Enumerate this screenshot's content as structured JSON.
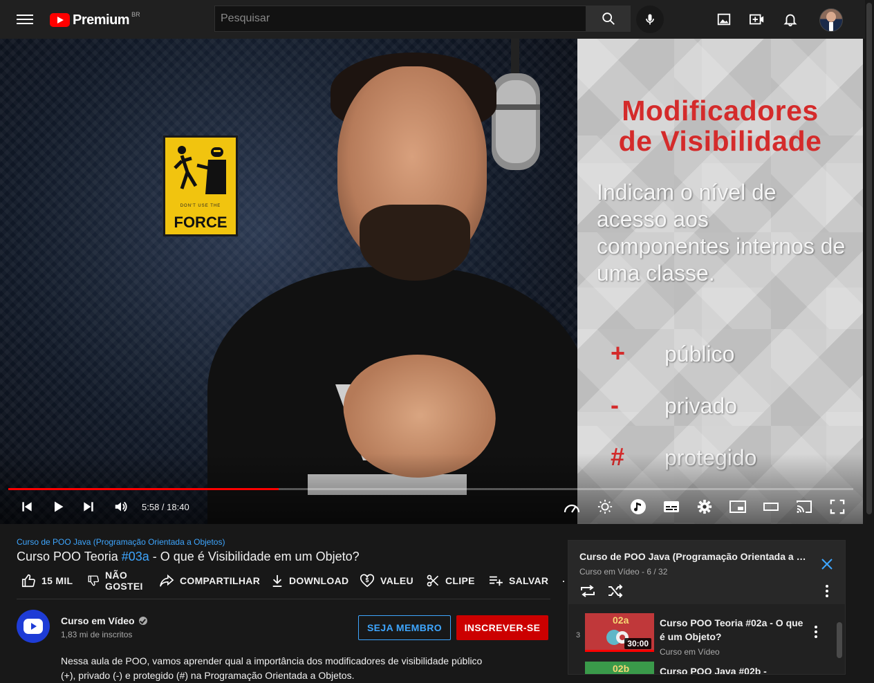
{
  "header": {
    "logo_text": "Premium",
    "country_code": "BR",
    "search_placeholder": "Pesquisar",
    "icons": [
      "menu-icon",
      "search-icon",
      "microphone-icon",
      "image-icon",
      "create-video-icon",
      "bell-icon"
    ]
  },
  "player": {
    "time_display": "5:58 / 18:40",
    "progress_fraction": 0.32,
    "slide": {
      "title_line1": "Modificadores",
      "title_line2": "de Visibilidade",
      "body": "Indicam o nível de acesso aos componentes internos de uma classe.",
      "items": [
        {
          "symbol": "+",
          "label": "público"
        },
        {
          "symbol": "-",
          "label": "privado"
        },
        {
          "symbol": "#",
          "label": "protegido"
        }
      ]
    },
    "sign": {
      "small_text": "DON'T USE THE",
      "big_text": "FORCE"
    }
  },
  "video": {
    "playlist_link": "Curso de POO Java (Programação Orientada a Objetos)",
    "title_prefix": "Curso POO Teoria ",
    "title_tag": "#03a",
    "title_suffix": " - O que é Visibilidade em um Objeto?",
    "actions": {
      "like": "15 MIL",
      "dislike_line1": "NÃO",
      "dislike_line2": "GOSTEI",
      "share": "COMPARTILHAR",
      "download": "DOWNLOAD",
      "thanks": "VALEU",
      "clip": "CLIPE",
      "save": "SALVAR",
      "more": "···"
    }
  },
  "channel": {
    "name": "Curso em Vídeo",
    "subscribers": "1,83 mi de inscritos",
    "member_label": "SEJA MEMBRO",
    "subscribe_label": "INSCREVER-SE",
    "description_line1": "Nessa aula de POO, vamos aprender qual a importância dos modificadores de visibilidade público",
    "description_line2": "(+), privado (-) e protegido (#) na Programação Orientada a Objetos."
  },
  "playlist": {
    "title": "Curso de POO Java (Programação Orientada a Objetos)",
    "subtitle": "Curso em Vídeo - 6 / 32",
    "items": [
      {
        "index": "3",
        "thumb_num": "02a",
        "title": "Curso POO Teoria #02a - O que é um Objeto?",
        "channel": "Curso em Vídeo",
        "duration": "30:00"
      },
      {
        "index": "",
        "thumb_num": "02b",
        "title": "Curso POO Java #02b -",
        "channel": "",
        "duration": ""
      }
    ]
  },
  "colors": {
    "accent_red": "#ff0000",
    "link_blue": "#3ea6ff",
    "subscribe_red": "#cc0000",
    "channel_blue": "#1e3cd6"
  }
}
